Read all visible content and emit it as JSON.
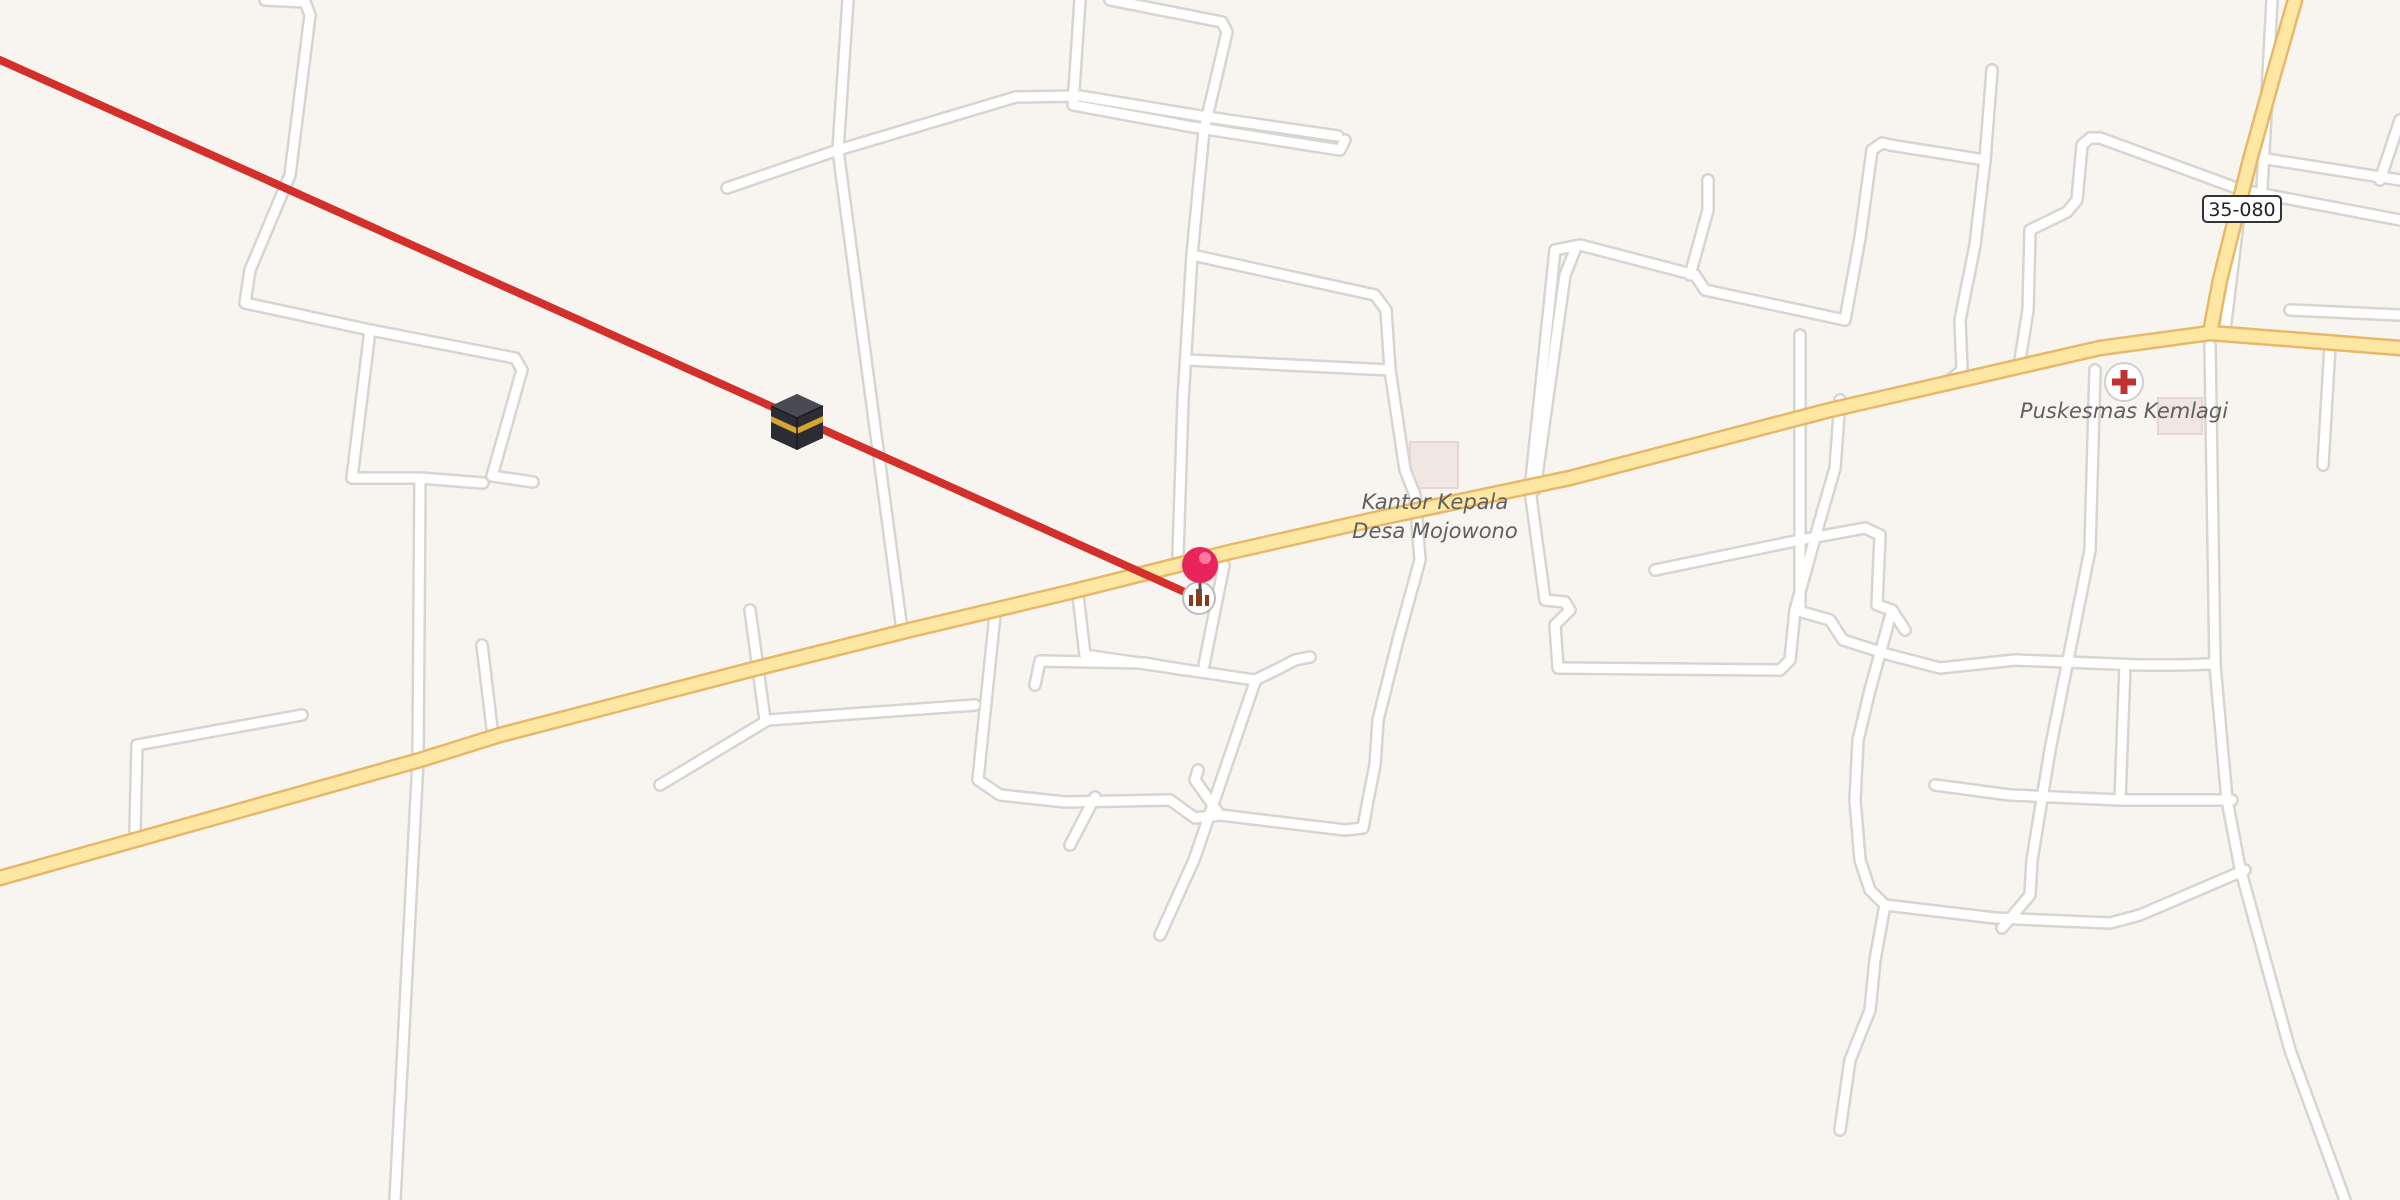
{
  "map": {
    "road_shield": "35-080",
    "places": [
      {
        "name_line1": "Kantor Kepala",
        "name_line2": "Desa Mojowono"
      },
      {
        "name_line1": "Puskesmas Kemlagi"
      }
    ],
    "markers": {
      "pin": "location-pin",
      "kaaba": "kaaba-icon",
      "mosque": "mosque-icon",
      "hospital": "hospital-icon"
    },
    "colors": {
      "background": "#f8f5f1",
      "minor_road": "#ffffff",
      "minor_road_casing": "#d8d4d0",
      "major_road": "#fde7a2",
      "major_road_casing": "#e6b96a",
      "qibla_line": "#d3302b",
      "pin": "#e9245a"
    }
  }
}
